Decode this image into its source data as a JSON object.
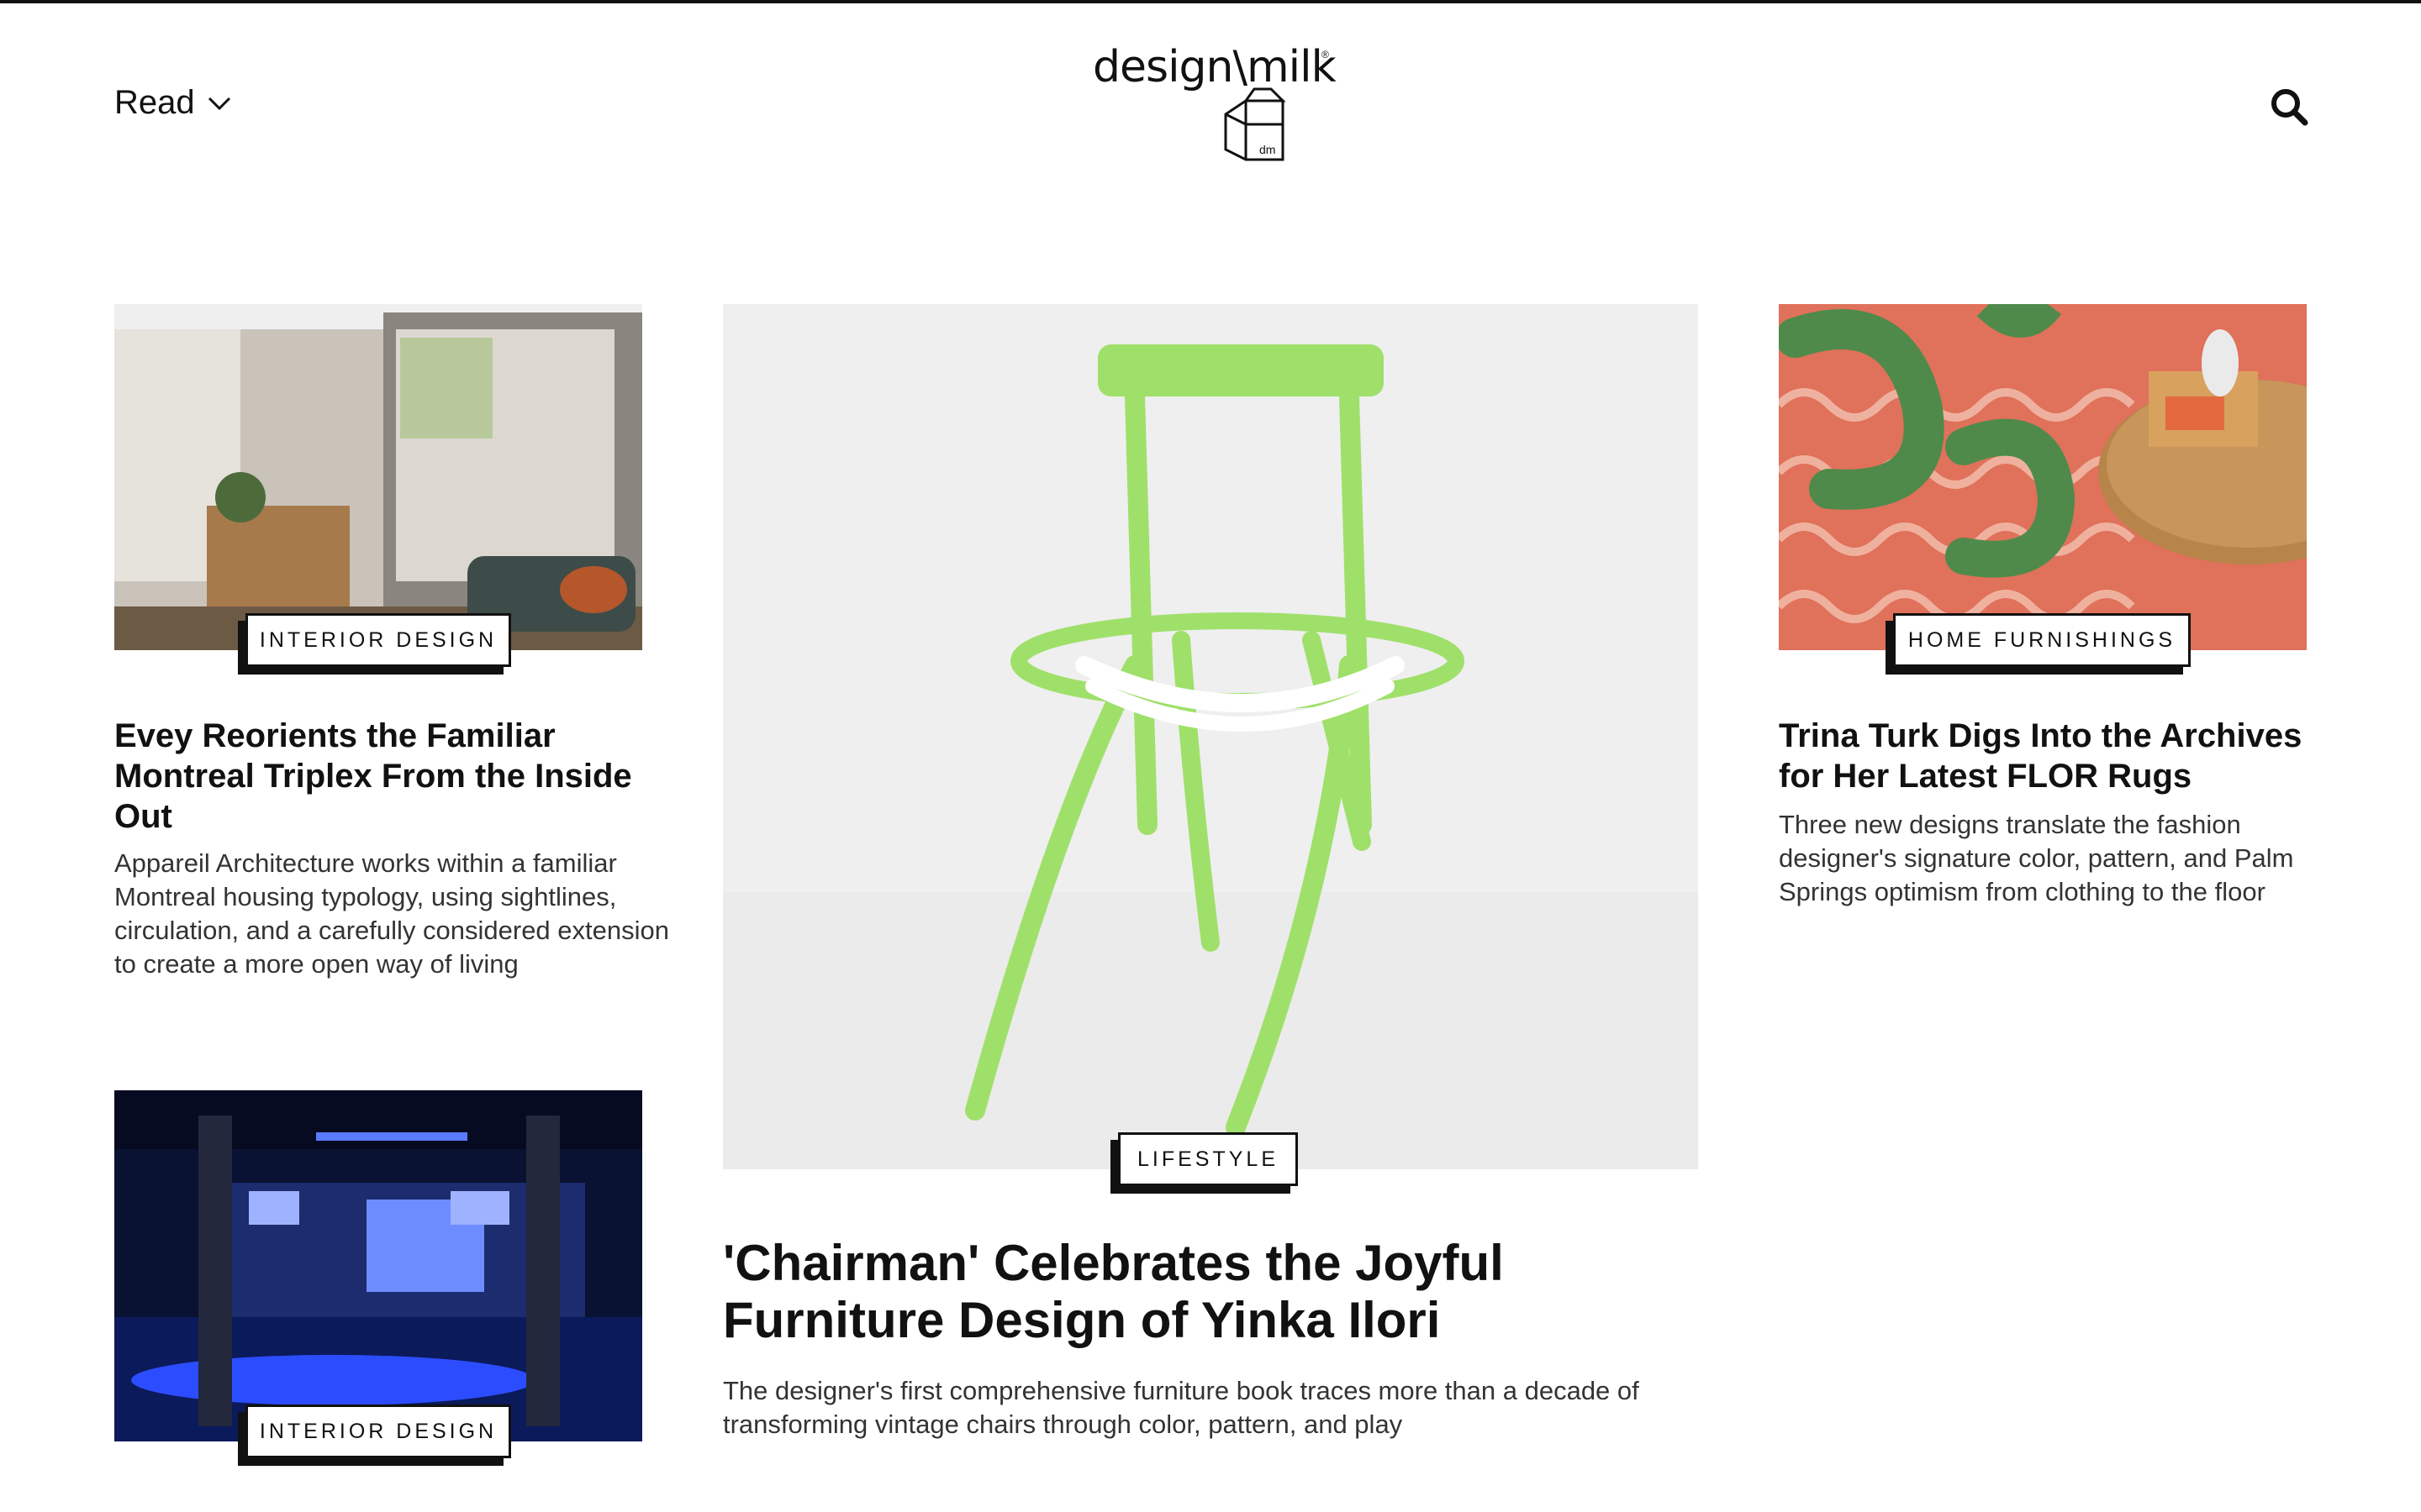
{
  "header": {
    "menu_label": "Read",
    "logo_text": "design\\milk",
    "logo_sub": "dm",
    "logo_mark": "®"
  },
  "icons": {
    "menu": "chevron-down-icon",
    "search": "search-icon"
  },
  "articles": [
    {
      "category": "INTERIOR DESIGN",
      "title": "Evey Reorients the Familiar Montreal Triplex From the Inside Out",
      "excerpt": "Appareil Architecture works within a familiar Montreal housing typology, using sightlines, circulation, and a carefully considered extension to create a more open way of living"
    },
    {
      "category": "LIFESTYLE",
      "title": "'Chairman' Celebrates the Joyful Furniture Design of Yinka Ilori",
      "excerpt": "The designer's first comprehensive furniture book traces more than a decade of transforming vintage chairs through color, pattern, and play"
    },
    {
      "category": "HOME FURNISHINGS",
      "title": "Trina Turk Digs Into the Archives for Her Latest FLOR Rugs",
      "excerpt": "Three new designs translate the fashion designer's signature color, pattern, and Palm Springs optimism from clothing to the floor"
    },
    {
      "category": "INTERIOR DESIGN"
    }
  ],
  "colors": {
    "text": "#111111",
    "chair_green": "#9fe06a",
    "rug_coral": "#e0715a",
    "club_blue": "#1a3cff"
  }
}
